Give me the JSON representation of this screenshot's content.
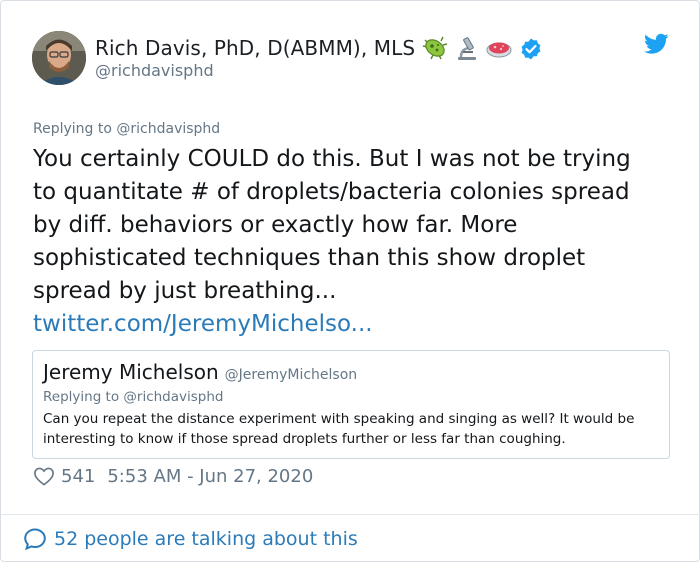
{
  "author": {
    "name": "Rich Davis, PhD, D(ABMM), MLS",
    "handle": "@richdavisphd",
    "name_emojis": [
      "microbe-emoji",
      "microscope-emoji",
      "petri-dish-emoji"
    ],
    "verified": true
  },
  "tweet": {
    "replying_prefix": "Replying to",
    "replying_to": "@richdavisphd",
    "text_lines": [
      "You certainly COULD do this. But I was not be trying",
      "to quantitate # of droplets/bacteria colonies spread",
      "by diff. behaviors or exactly how far. More",
      "sophisticated techniques than this show droplet",
      "spread by just breathing..."
    ],
    "link": "twitter.com/JeremyMichelso..."
  },
  "quoted_tweet": {
    "name": "Jeremy Michelson",
    "handle": "@JeremyMichelson",
    "replying_prefix": "Replying to",
    "replying_to": "@richdavisphd",
    "text_lines": [
      "Can you repeat the distance experiment with speaking and singing as well? It would be",
      "interesting to know if those spread droplets further or less far than coughing."
    ]
  },
  "meta": {
    "like_count": "541",
    "timestamp": "5:53 AM - Jun 27, 2020"
  },
  "footer": {
    "talking_text": "52 people are talking about this"
  },
  "colors": {
    "link": "#2b7bb9",
    "twitter_blue": "#1da1f2",
    "muted_text": "#657786",
    "verified_badge": "#1da1f2"
  }
}
